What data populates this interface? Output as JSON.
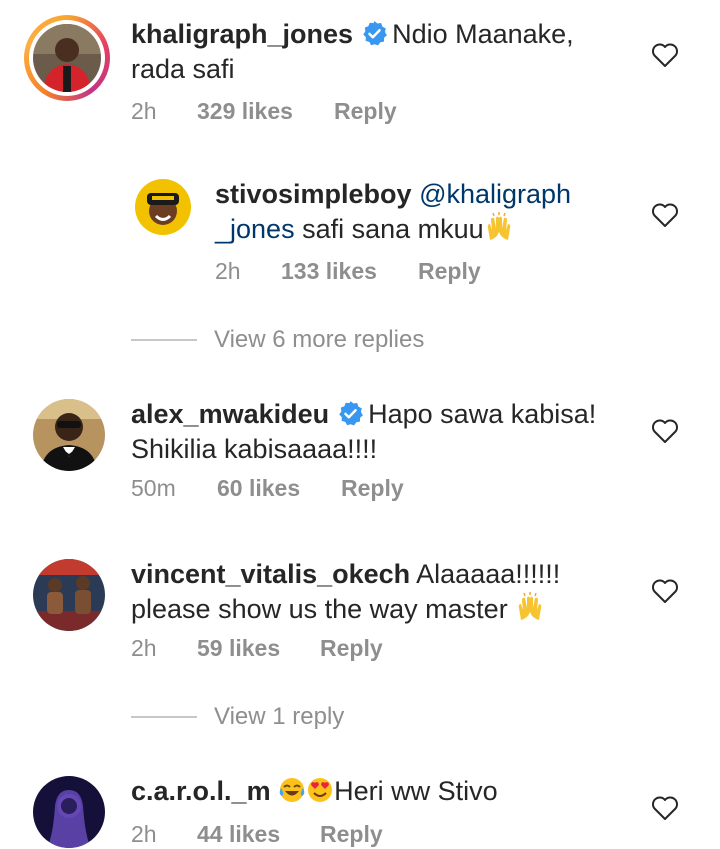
{
  "comments": [
    {
      "username": "khaligraph_jones",
      "verified": true,
      "text_line1": "Ndio Maanake,",
      "text_line2": "rada safi",
      "time": "2h",
      "likes": "329 likes",
      "reply": "Reply"
    },
    {
      "username": "stivosimpleboy",
      "mention_part1": "@khaligraph",
      "mention_part2": "_jones",
      "text": " safi sana mkuu",
      "emoji": "raising-hands",
      "time": "2h",
      "likes": "133 likes",
      "reply": "Reply"
    },
    {
      "username": "alex_mwakideu",
      "verified": true,
      "text_line1": "Hapo sawa kabisa!",
      "text_line2": "Shikilia kabisaaaa!!!!",
      "time": "50m",
      "likes": "60 likes",
      "reply": "Reply"
    },
    {
      "username": "vincent_vitalis_okech",
      "text_line1": "Alaaaaa!!!!!!",
      "text_line2": "please show us the way master ",
      "emoji": "raising-hands",
      "time": "2h",
      "likes": "59 likes",
      "reply": "Reply"
    },
    {
      "username": "c.a.r.o.l._m",
      "emojis": [
        "tears-of-joy",
        "heart-eyes"
      ],
      "text": "Heri ww Stivo",
      "time": "2h",
      "likes": "44 likes",
      "reply": "Reply"
    }
  ],
  "view_more_1": "View 6 more replies",
  "view_more_2": "View 1 reply",
  "colors": {
    "text": "#262626",
    "muted": "#8e8e8e",
    "mention": "#00376b",
    "verified": "#3897f0"
  }
}
